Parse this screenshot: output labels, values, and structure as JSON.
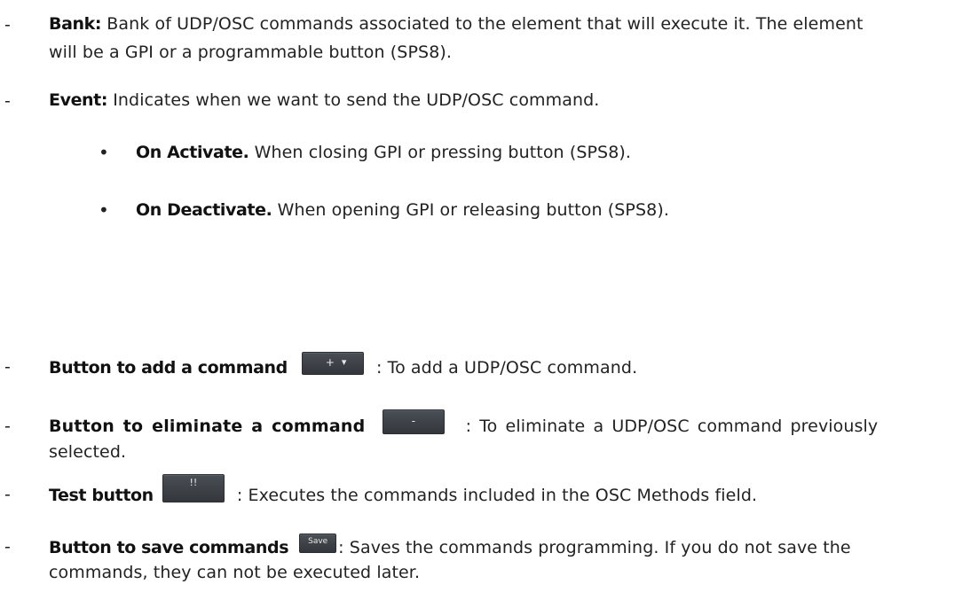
{
  "dash": "-",
  "bullet": "•",
  "bank": {
    "term": "Bank:",
    "text1": " Bank of UDP/OSC commands associated to the element that will execute it. The element",
    "text2": "will be a GPI or a programmable button (SPS8)."
  },
  "event": {
    "term": "Event:",
    "text": " Indicates when we want to send the UDP/OSC command."
  },
  "on_activate": {
    "term": "On Activate.",
    "text": " When closing GPI or pressing button (SPS8)."
  },
  "on_deactivate": {
    "term": "On Deactivate.",
    "text": " When opening GPI or releasing button (SPS8)."
  },
  "add": {
    "term": "Button to add a command",
    "btn_plus": "+",
    "btn_caret": "▾",
    "text": ": To add a UDP/OSC command."
  },
  "eliminate": {
    "term": "Button to eliminate a command",
    "btn_label": "-",
    "text1": ": To eliminate a UDP/OSC command previously",
    "text2": "selected."
  },
  "test": {
    "term": "Test button",
    "btn_label": "!!",
    "text": ": Executes the commands included in the OSC Methods field."
  },
  "save": {
    "term": "Button to save commands",
    "btn_label": "Save",
    "text1": ": Saves the commands programming. If you do not save the",
    "text2": "commands, they can not be executed later."
  }
}
